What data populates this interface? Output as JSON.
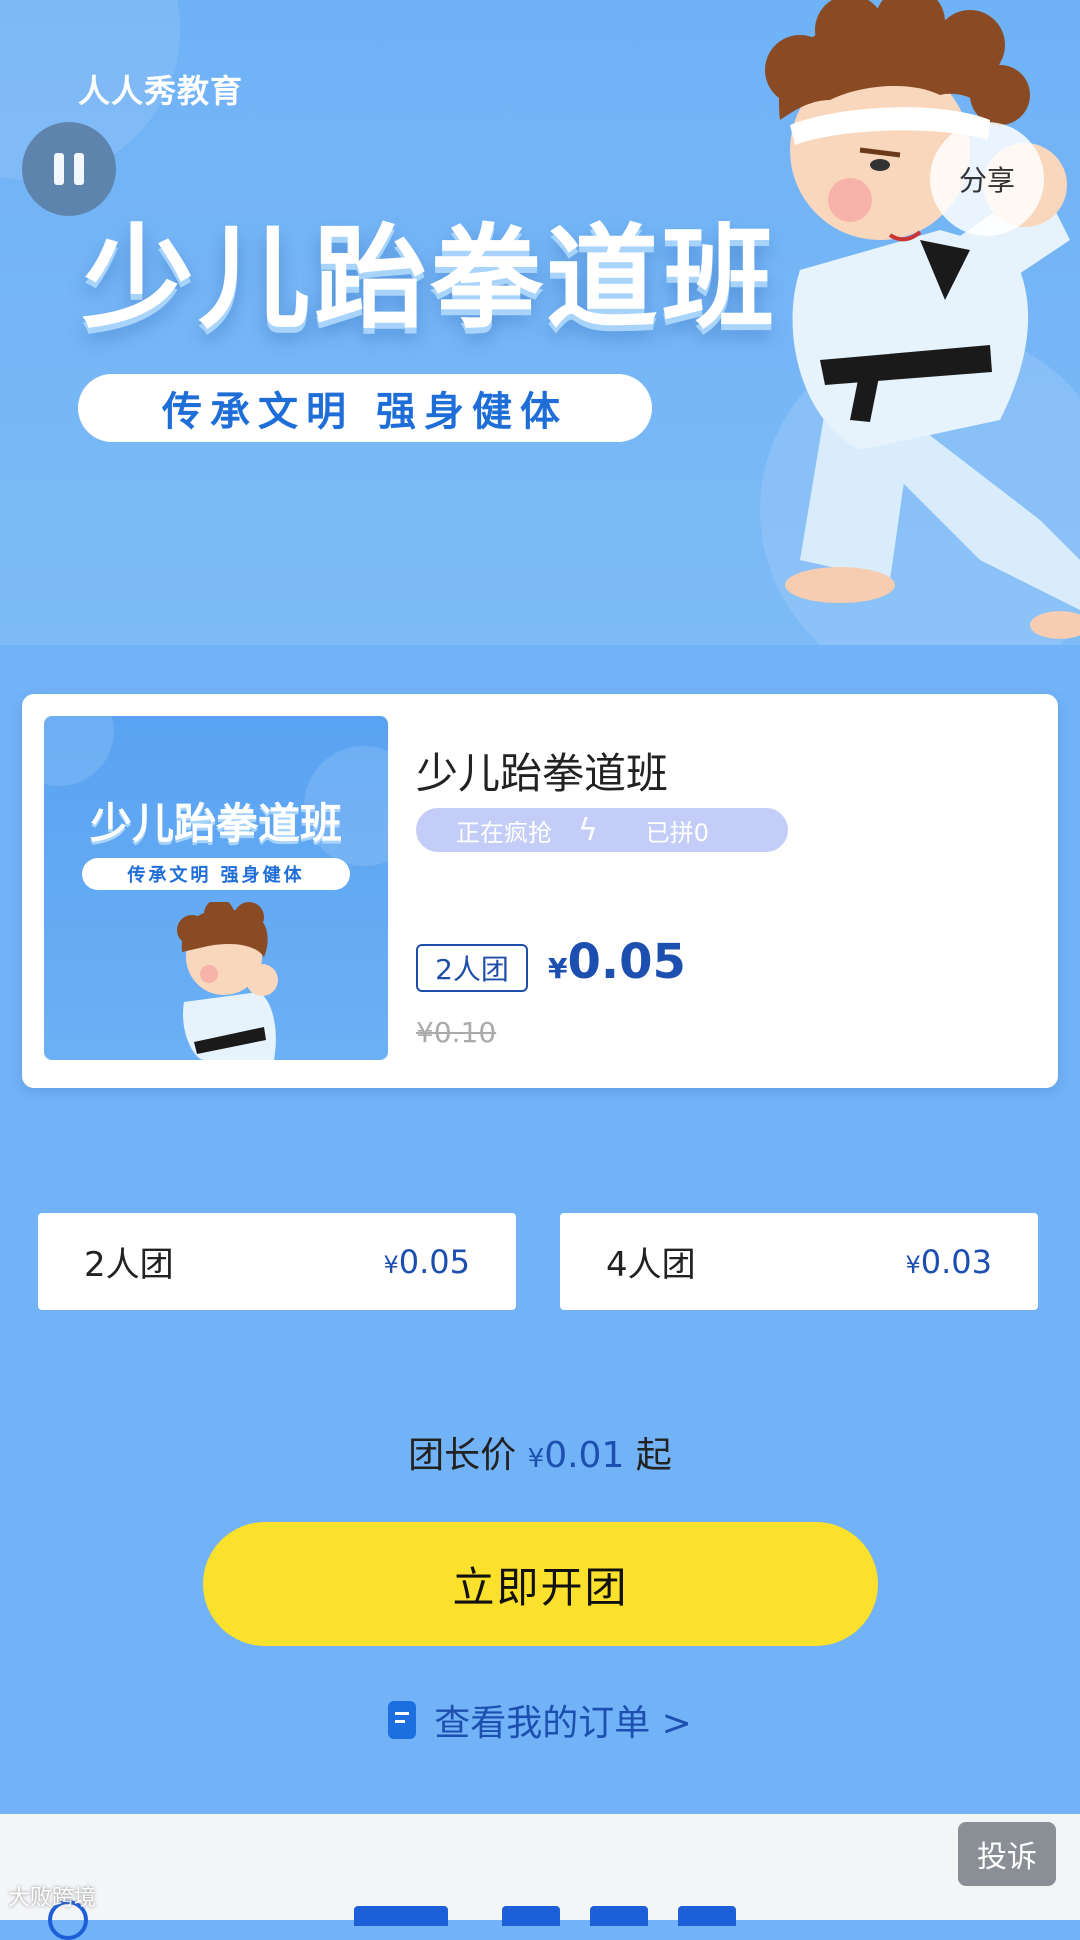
{
  "banner": {
    "brand": "人人秀教育",
    "title": "少儿跆拳道班",
    "slogan": "传承文明 强身健体",
    "share_label": "分享"
  },
  "product": {
    "thumb_title": "少儿跆拳道班",
    "thumb_slogan": "传承文明 强身健体",
    "title": "少儿跆拳道班",
    "hot_label": "正在疯抢",
    "joined_label": "已拼0",
    "group_badge": "2人团",
    "currency": "¥",
    "price": "0.05",
    "original_price": "¥0.10"
  },
  "options": [
    {
      "label": "2人团",
      "currency": "¥",
      "price": "0.05"
    },
    {
      "label": "4人团",
      "currency": "¥",
      "price": "0.03"
    }
  ],
  "leader": {
    "prefix": "团长价",
    "currency": "¥",
    "price": "0.01",
    "suffix": "起"
  },
  "cta_label": "立即开团",
  "orders_label": "查看我的订单 >",
  "complain_label": "投诉",
  "watermark": "大败跨境",
  "colors": {
    "background": "#72b2f6",
    "accent_blue": "#1d4fb0",
    "cta_yellow": "#fbe12c"
  }
}
